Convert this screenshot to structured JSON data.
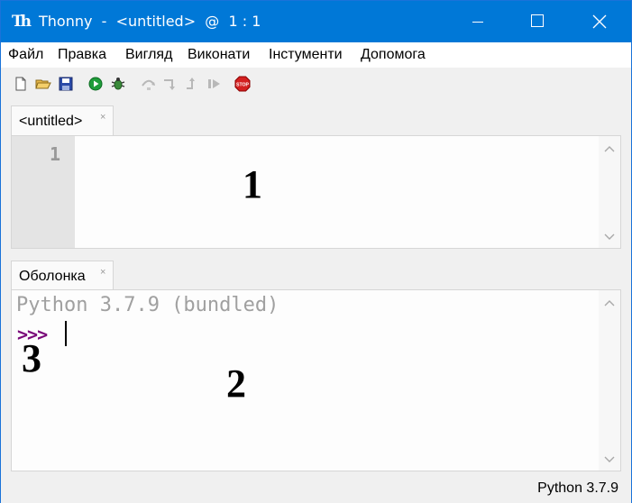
{
  "window": {
    "title": "Thonny  -  <untitled>  @  1 : 1",
    "icon_text": "Th",
    "accent_color": "#0078d7"
  },
  "menu": {
    "items": [
      "Файл",
      "Правка",
      "Вигляд",
      "Виконати",
      "Інстументи",
      "Допомога"
    ]
  },
  "toolbar": {
    "buttons": [
      "new-file",
      "open-file",
      "save-file",
      "run",
      "debug",
      "step-over",
      "step-into",
      "step-out",
      "resume",
      "stop"
    ],
    "stop_label": "STOP"
  },
  "editor": {
    "tab_label": "<untitled>",
    "tab_close": "×",
    "line_number": "1"
  },
  "shell": {
    "tab_label": "Оболонка",
    "tab_close": "×",
    "banner": "Python 3.7.9 (bundled)",
    "prompt": ">>>"
  },
  "annotations": {
    "editor_marker": "1",
    "shell_marker": "2",
    "prompt_marker": "3"
  },
  "status": {
    "interpreter": "Python 3.7.9"
  }
}
